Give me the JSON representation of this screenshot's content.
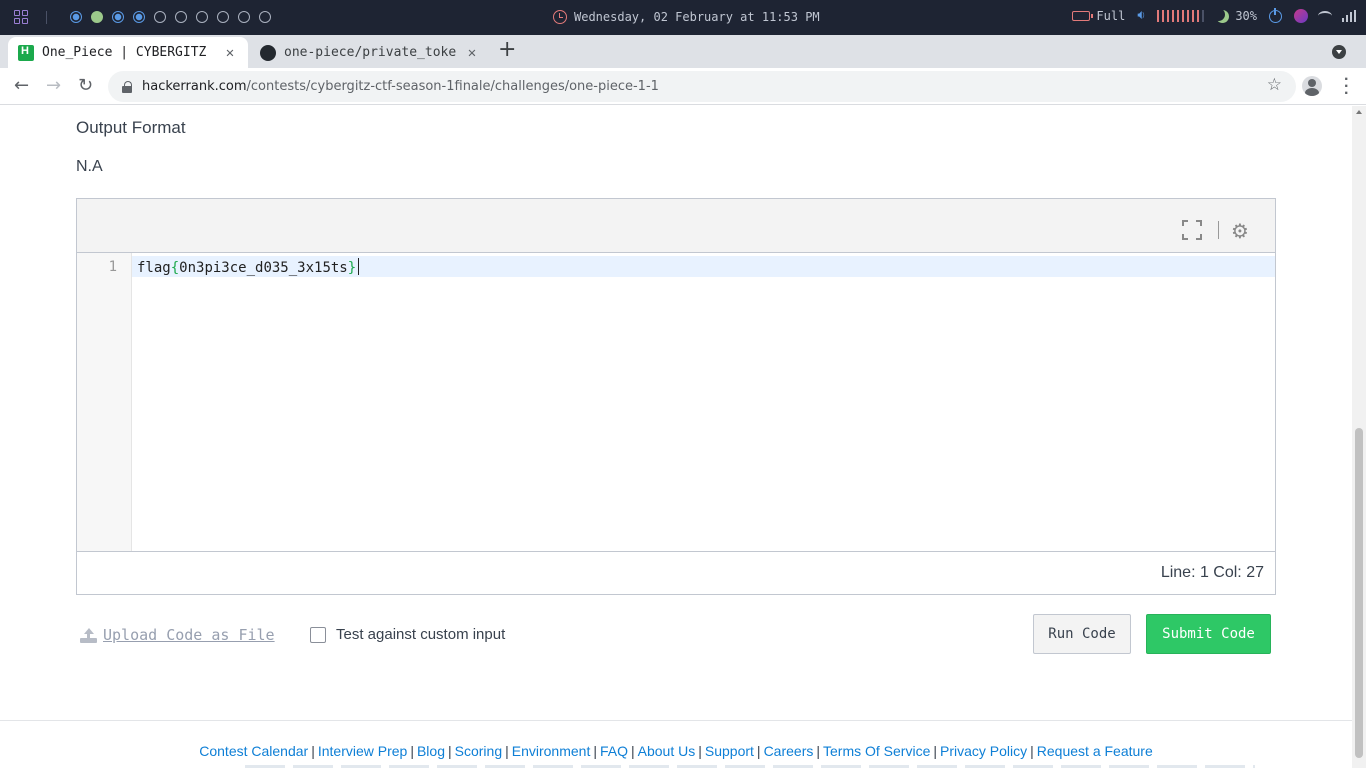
{
  "os_bar": {
    "datetime": "Wednesday, 02 February at 11:53 PM",
    "battery_label": "Full",
    "brightness": "30%",
    "workspaces": [
      {
        "state": "active"
      },
      {
        "state": "green"
      },
      {
        "state": "active"
      },
      {
        "state": "active"
      },
      {
        "state": "empty"
      },
      {
        "state": "empty"
      },
      {
        "state": "empty"
      },
      {
        "state": "empty"
      },
      {
        "state": "empty"
      },
      {
        "state": "empty"
      }
    ],
    "volume_level": 0.9
  },
  "browser": {
    "tabs": [
      {
        "title": "One_Piece | CYBERGITZ",
        "active": true,
        "icon": "hackerrank-icon"
      },
      {
        "title": "one-piece/private_toke",
        "active": false,
        "icon": "github-icon"
      }
    ],
    "url_host": "hackerrank.com",
    "url_path": "/contests/cybergitz-ctf-season-1finale/challenges/one-piece-1-1"
  },
  "page": {
    "section_title": "Output Format",
    "section_text": "N.A",
    "editor": {
      "line_number": "1",
      "code_prefix": "flag",
      "code_open_brace": "{",
      "code_body": "0n3pi3ce_d035_3x15ts",
      "code_close_brace": "}",
      "status": "Line: 1 Col: 27"
    },
    "actions": {
      "upload_label": "Upload Code as File",
      "custom_input_label": "Test against custom input",
      "run_label": "Run Code",
      "submit_label": "Submit Code"
    },
    "footer_links": [
      "Contest Calendar",
      "Interview Prep",
      "Blog",
      "Scoring",
      "Environment",
      "FAQ",
      "About Us",
      "Support",
      "Careers",
      "Terms Of Service",
      "Privacy Policy",
      "Request a Feature"
    ]
  },
  "colors": {
    "submit": "#2ec866",
    "link": "#0e7fd6",
    "os_bg": "#1e2433"
  }
}
